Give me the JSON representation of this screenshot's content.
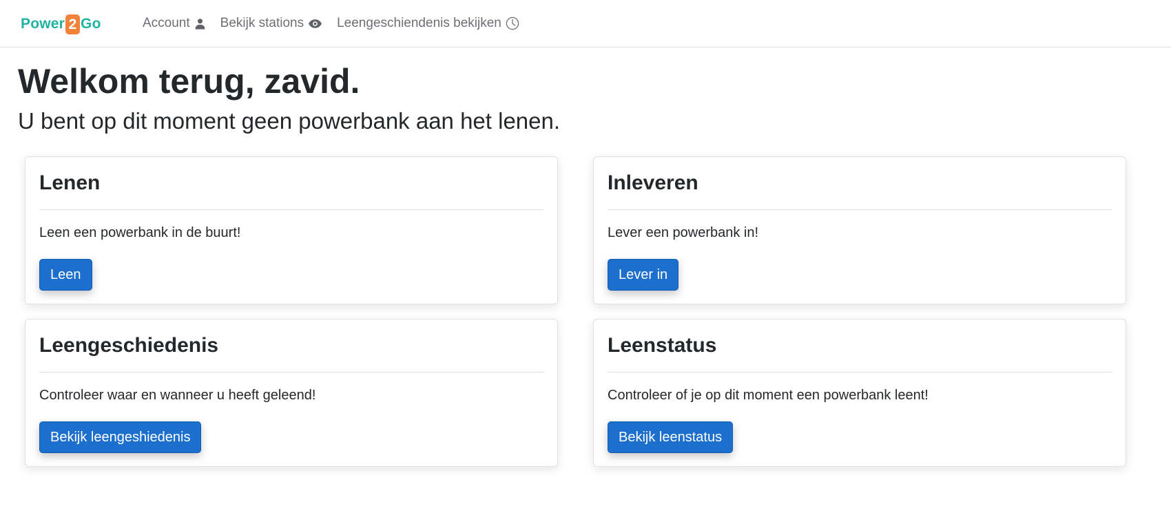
{
  "brand": {
    "part1": "Power",
    "part2": "2",
    "part3": "Go",
    "color_primary": "#1fb3a2",
    "color_accent": "#f2823a"
  },
  "nav": {
    "items": [
      {
        "label": "Account",
        "icon": "person-icon"
      },
      {
        "label": "Bekijk stations",
        "icon": "eye-icon"
      },
      {
        "label": "Leengeschiendenis bekijken",
        "icon": "clock-icon"
      }
    ]
  },
  "main": {
    "title": "Welkom terug, zavid.",
    "subtitle": "U bent op dit moment geen powerbank aan het lenen."
  },
  "cards": [
    {
      "title": "Lenen",
      "text": "Leen een powerbank in de buurt!",
      "button": "Leen"
    },
    {
      "title": "Inleveren",
      "text": "Lever een powerbank in!",
      "button": "Lever in"
    },
    {
      "title": "Leengeschiedenis",
      "text": "Controleer waar en wanneer u heeft geleend!",
      "button": "Bekijk leengeshiedenis"
    },
    {
      "title": "Leenstatus",
      "text": "Controleer of je op dit moment een powerbank leent!",
      "button": "Bekijk leenstatus"
    }
  ],
  "colors": {
    "button": "#1c6fcc",
    "text": "#25282b",
    "nav_text": "#6c6f73"
  }
}
